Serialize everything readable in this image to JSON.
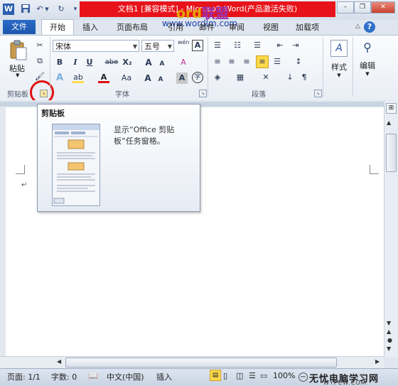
{
  "title_bar": {
    "app_icon": "W",
    "window_title": "文档1 [兼容模式] - Microsoft Word(产品激活失败)",
    "watermark_brand_left": "ord",
    "watermark_brand_right": "联盟",
    "watermark_url": "www.wordlm.com",
    "qat_icons": [
      "save-icon",
      "undo-icon",
      "redo-icon",
      "customize-icon"
    ],
    "controls": {
      "minimize": "–",
      "restore": "❐",
      "close": "✕"
    }
  },
  "tabs": {
    "file": "文件",
    "items": [
      "开始",
      "插入",
      "页面布局",
      "引用",
      "邮件",
      "审阅",
      "视图",
      "加载项"
    ],
    "active": "开始",
    "help_icon": "?"
  },
  "ribbon": {
    "clipboard": {
      "label": "剪贴板",
      "paste": "粘贴"
    },
    "font": {
      "label": "字体",
      "font_name": "宋体",
      "font_size": "五号",
      "wen_icon": "wén",
      "format_buttons": [
        "B",
        "I",
        "U",
        "abe",
        "X₂",
        "X²"
      ],
      "grow": "A",
      "shrink": "A",
      "case": "Aa",
      "clear_format": "A"
    },
    "paragraph": {
      "label": "段落"
    },
    "styles": {
      "label": "样式"
    },
    "editing": {
      "label": "编辑"
    }
  },
  "tooltip": {
    "title": "剪贴板",
    "description": "显示“Office 剪贴板”任务窗格。"
  },
  "document": {
    "paragraph_mark": "↵"
  },
  "status_bar": {
    "page": "页面: 1/1",
    "words": "字数: 0",
    "language": "中文(中国)",
    "mode": "插入",
    "zoom": "100%",
    "zoom_out": "−"
  },
  "bottom_watermark": {
    "text": "无忧电脑学习网",
    "url": "WYPCW.COM"
  },
  "colors": {
    "title_red": "#e8131a",
    "file_tab": "#2a6bc7",
    "highlight_yellow": "#ffd94a",
    "annotation_circle": "#e01010"
  }
}
